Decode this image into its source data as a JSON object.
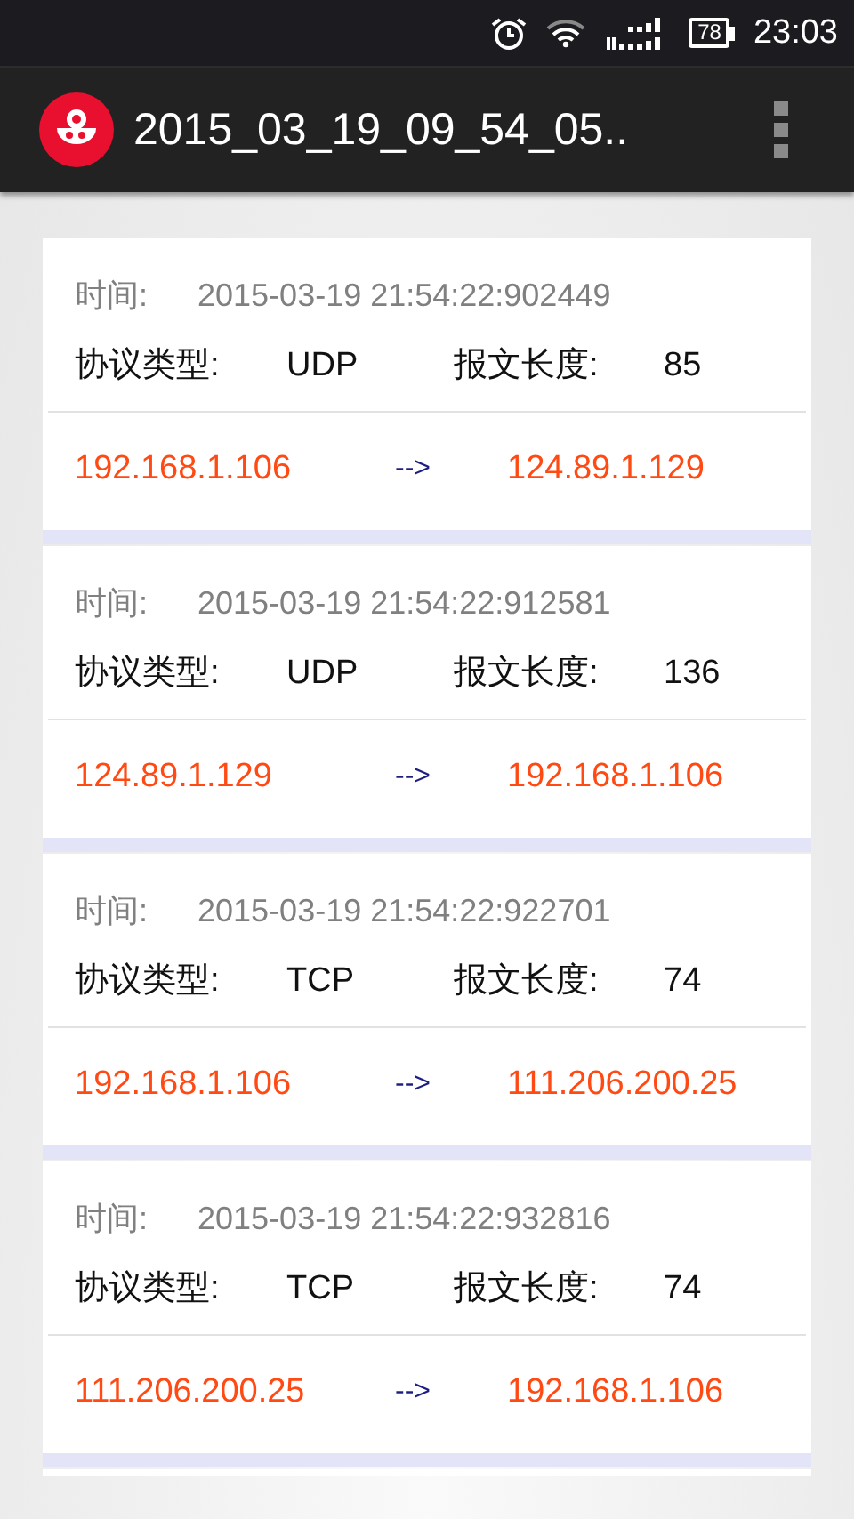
{
  "status_bar": {
    "battery": "78",
    "time": "23:03"
  },
  "action_bar": {
    "title": "2015_03_19_09_54_05.."
  },
  "packets": [
    {
      "time_label": "时间:",
      "time": "2015-03-19 21:54:22:902449",
      "protocol_label": "协议类型:",
      "protocol": "UDP",
      "length_label": "报文长度:",
      "length": "85",
      "source": "192.168.1.106",
      "arrow": "-->",
      "destination": "124.89.1.129"
    },
    {
      "time_label": "时间:",
      "time": "2015-03-19 21:54:22:912581",
      "protocol_label": "协议类型:",
      "protocol": "UDP",
      "length_label": "报文长度:",
      "length": "136",
      "source": "124.89.1.129",
      "arrow": "-->",
      "destination": "192.168.1.106"
    },
    {
      "time_label": "时间:",
      "time": "2015-03-19 21:54:22:922701",
      "protocol_label": "协议类型:",
      "protocol": "TCP",
      "length_label": "报文长度:",
      "length": "74",
      "source": "192.168.1.106",
      "arrow": "-->",
      "destination": "111.206.200.25"
    },
    {
      "time_label": "时间:",
      "time": "2015-03-19 21:54:22:932816",
      "protocol_label": "协议类型:",
      "protocol": "TCP",
      "length_label": "报文长度:",
      "length": "74",
      "source": "111.206.200.25",
      "arrow": "-->",
      "destination": "192.168.1.106"
    }
  ]
}
